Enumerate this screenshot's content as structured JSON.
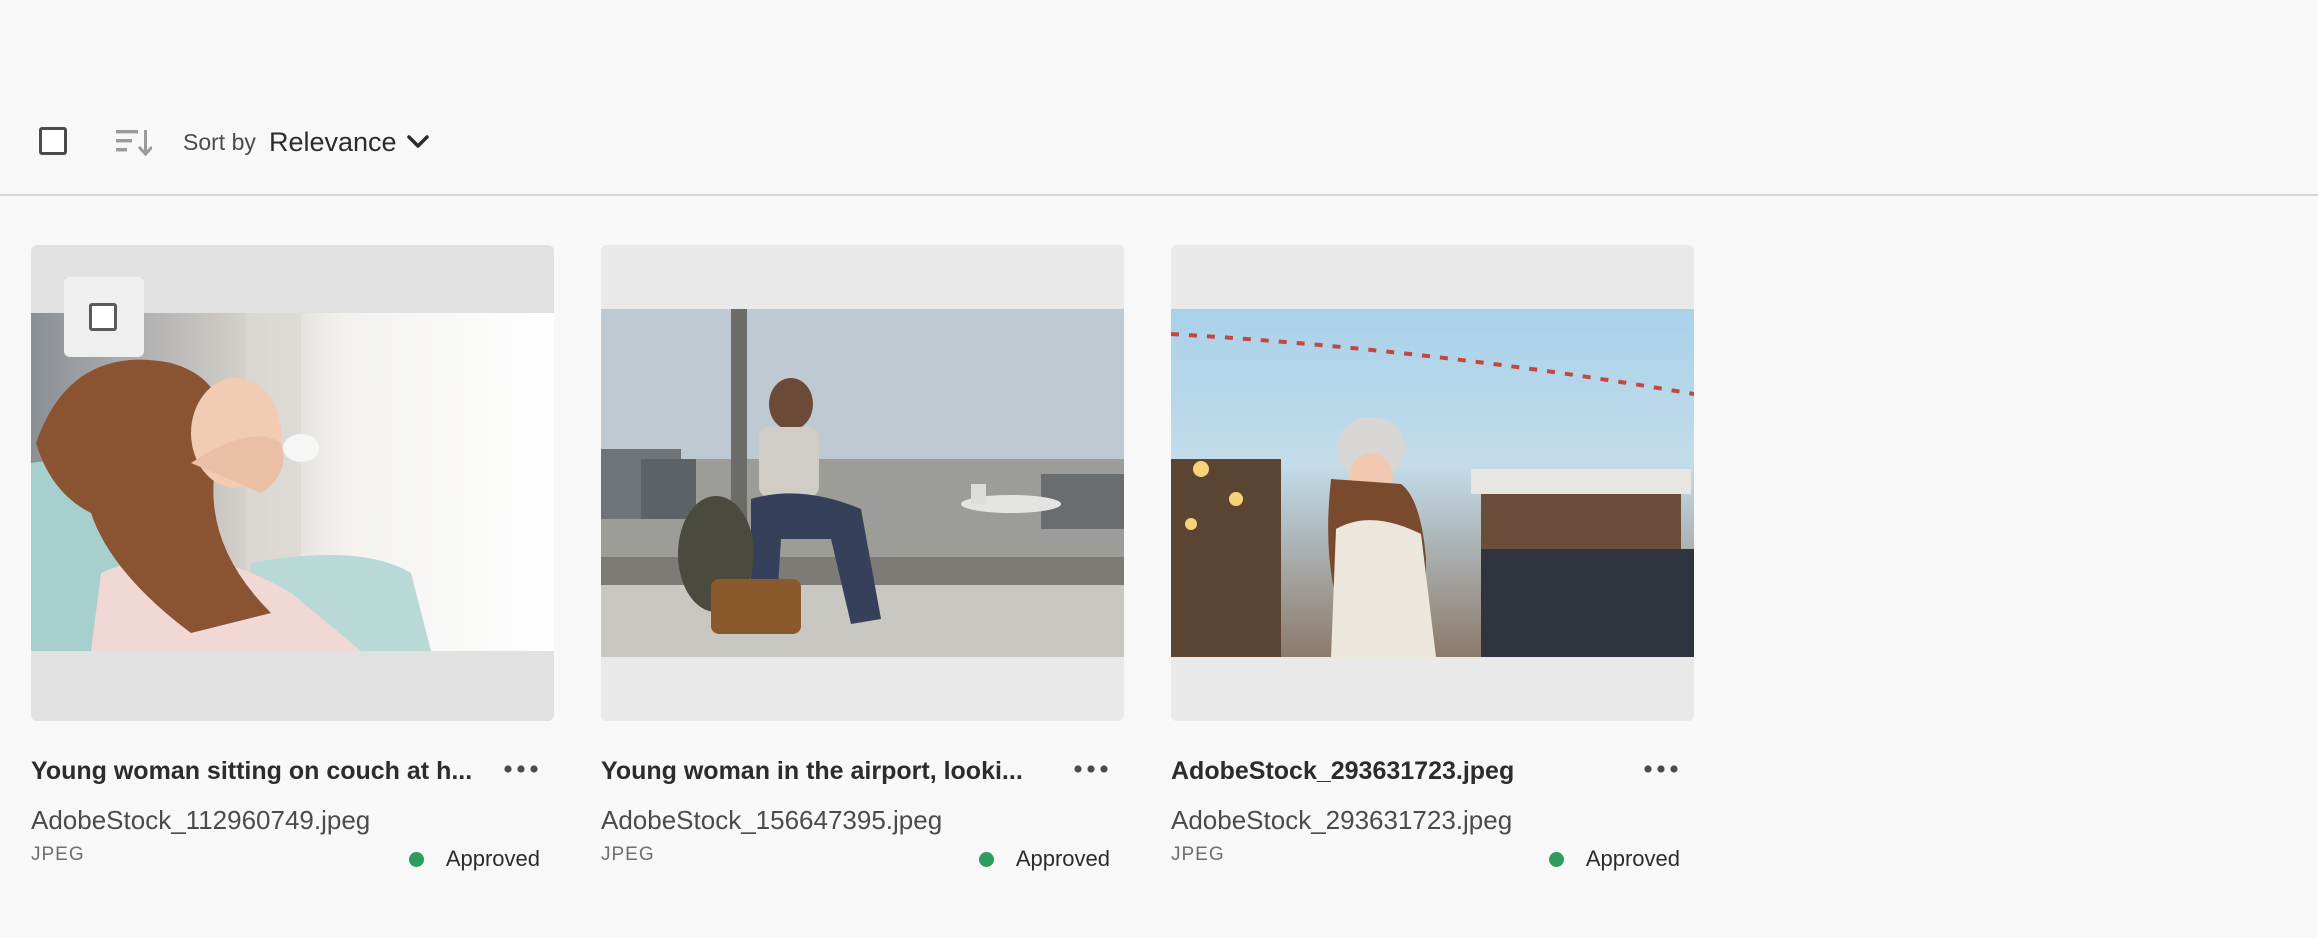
{
  "toolbar": {
    "sort_by_label": "Sort by",
    "sort_value": "Relevance"
  },
  "assets": [
    {
      "title": "Young woman sitting on couch at h...",
      "filename": "AdobeStock_112960749.jpeg",
      "type": "JPEG",
      "status": "Approved"
    },
    {
      "title": "Young woman in the airport, looki...",
      "filename": "AdobeStock_156647395.jpeg",
      "type": "JPEG",
      "status": "Approved"
    },
    {
      "title": "AdobeStock_293631723.jpeg",
      "filename": "AdobeStock_293631723.jpeg",
      "type": "JPEG",
      "status": "Approved"
    }
  ],
  "colors": {
    "approved": "#2d9d5f",
    "background": "#f8f8f8",
    "card_bg": "#e9e9e9"
  }
}
